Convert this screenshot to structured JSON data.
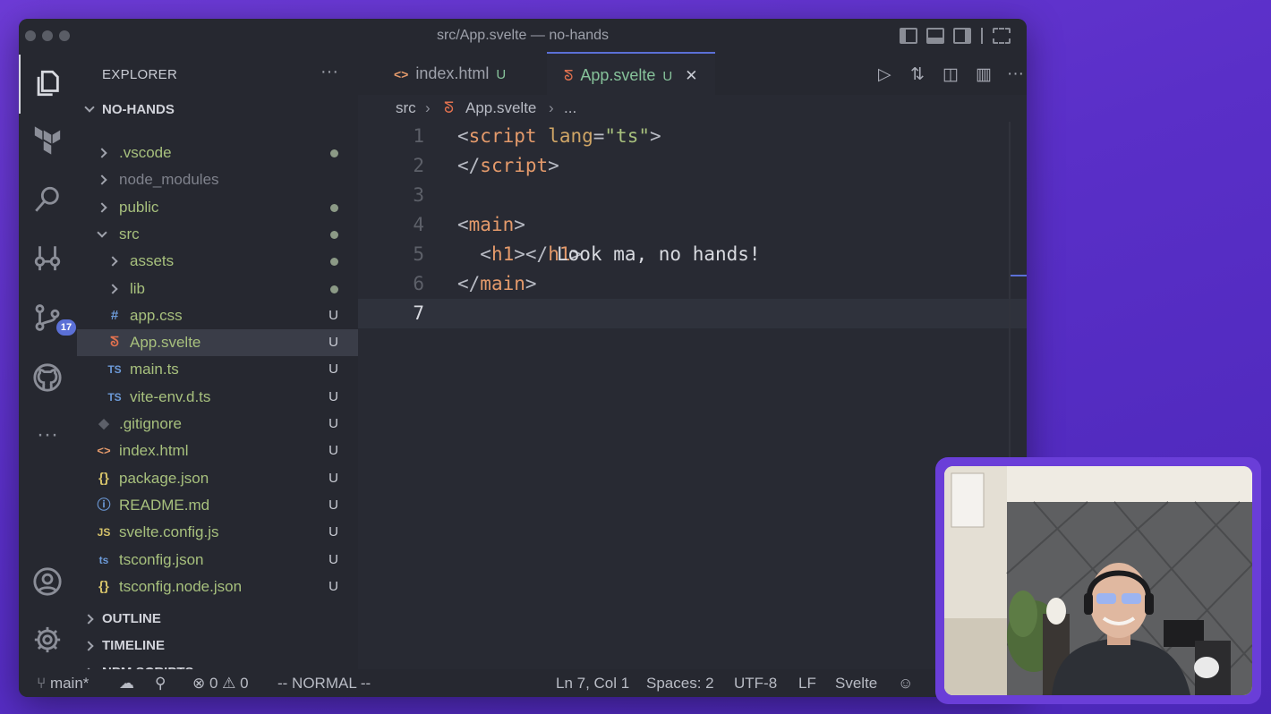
{
  "window": {
    "title": "src/App.svelte — no-hands"
  },
  "sidebar": {
    "header": "EXPLORER",
    "more": "···",
    "root": "NO-HANDS",
    "tree": [
      {
        "label": ".vscode",
        "kind": "folder",
        "depth": 1,
        "open": false,
        "status": "dot",
        "color": "#a7c07d"
      },
      {
        "label": "node_modules",
        "kind": "folder",
        "depth": 1,
        "open": false,
        "status": "",
        "color": "#7f828c"
      },
      {
        "label": "public",
        "kind": "folder",
        "depth": 1,
        "open": false,
        "status": "dot",
        "color": "#a7c07d"
      },
      {
        "label": "src",
        "kind": "folder",
        "depth": 1,
        "open": true,
        "status": "dot",
        "color": "#a7c07d"
      },
      {
        "label": "assets",
        "kind": "folder",
        "depth": 2,
        "open": false,
        "status": "dot",
        "color": "#a7c07d"
      },
      {
        "label": "lib",
        "kind": "folder",
        "depth": 2,
        "open": false,
        "status": "dot",
        "color": "#a7c07d"
      },
      {
        "label": "app.css",
        "kind": "file",
        "icon": "#",
        "depth": 2,
        "status": "U",
        "color": "#a7c07d",
        "iconColor": "#6c9ad8"
      },
      {
        "label": "App.svelte",
        "kind": "file",
        "icon": "svelte",
        "depth": 2,
        "status": "U",
        "color": "#a7c07d",
        "iconColor": "#e0714f",
        "selected": true
      },
      {
        "label": "main.ts",
        "kind": "file",
        "icon": "TS",
        "depth": 2,
        "status": "U",
        "color": "#a7c07d",
        "iconColor": "#6c9ad8"
      },
      {
        "label": "vite-env.d.ts",
        "kind": "file",
        "icon": "TS",
        "depth": 2,
        "status": "U",
        "color": "#a7c07d",
        "iconColor": "#6c9ad8"
      },
      {
        "label": ".gitignore",
        "kind": "file",
        "icon": "◆",
        "depth": 1,
        "status": "U",
        "color": "#a7c07d",
        "iconColor": "#5d6069"
      },
      {
        "label": "index.html",
        "kind": "file",
        "icon": "<>",
        "depth": 1,
        "status": "U",
        "color": "#a7c07d",
        "iconColor": "#e49a6b"
      },
      {
        "label": "package.json",
        "kind": "file",
        "icon": "{}",
        "depth": 1,
        "status": "U",
        "color": "#a7c07d",
        "iconColor": "#d6c36a"
      },
      {
        "label": "README.md",
        "kind": "file",
        "icon": "ⓘ",
        "depth": 1,
        "status": "U",
        "color": "#a7c07d",
        "iconColor": "#6c9ad8"
      },
      {
        "label": "svelte.config.js",
        "kind": "file",
        "icon": "JS",
        "depth": 1,
        "status": "U",
        "color": "#a7c07d",
        "iconColor": "#d6c36a"
      },
      {
        "label": "tsconfig.json",
        "kind": "file",
        "icon": "ts",
        "depth": 1,
        "status": "U",
        "color": "#a7c07d",
        "iconColor": "#6c9ad8"
      },
      {
        "label": "tsconfig.node.json",
        "kind": "file",
        "icon": "{}",
        "depth": 1,
        "status": "U",
        "color": "#a7c07d",
        "iconColor": "#d6c36a"
      }
    ],
    "panels": [
      "OUTLINE",
      "TIMELINE",
      "NPM SCRIPTS"
    ]
  },
  "activity": {
    "scm_badge": "17"
  },
  "tabs": [
    {
      "label": "index.html",
      "status": "U",
      "icon": "<>",
      "active": false
    },
    {
      "label": "App.svelte",
      "status": "U",
      "icon": "svelte",
      "active": true,
      "close": "✕"
    }
  ],
  "breadcrumb": {
    "folder": "src",
    "file": "App.svelte",
    "rest": "..."
  },
  "code": [
    {
      "n": "1",
      "tokens": [
        [
          "pu",
          "<"
        ],
        [
          "tg",
          "script"
        ],
        [
          "pu",
          " "
        ],
        [
          "at",
          "lang"
        ],
        [
          "pu",
          "="
        ],
        [
          "str",
          "\"ts\""
        ],
        [
          "pu",
          ">"
        ]
      ]
    },
    {
      "n": "2",
      "tokens": [
        [
          "pu",
          "</"
        ],
        [
          "tg",
          "script"
        ],
        [
          "pu",
          ">"
        ]
      ]
    },
    {
      "n": "3",
      "tokens": []
    },
    {
      "n": "4",
      "tokens": [
        [
          "pu",
          "<"
        ],
        [
          "tg",
          "main"
        ],
        [
          "pu",
          ">"
        ]
      ]
    },
    {
      "n": "5",
      "tokens": [
        [
          "pu",
          "  <"
        ],
        [
          "tg",
          "h1"
        ],
        [
          "pu",
          ">"
        ],
        [
          "src",
          "Look ma, no hands!"
        ],
        [
          "pu",
          "</"
        ],
        [
          "tg",
          "h1"
        ],
        [
          "pu",
          ">"
        ]
      ]
    },
    {
      "n": "6",
      "tokens": [
        [
          "pu",
          "</"
        ],
        [
          "tg",
          "main"
        ],
        [
          "pu",
          ">"
        ]
      ]
    },
    {
      "n": "7",
      "tokens": [],
      "current": true
    }
  ],
  "status": {
    "branch": "main*",
    "errors": "0",
    "warnings": "0",
    "mode": "-- NORMAL --",
    "position": "Ln 7, Col 1",
    "spaces": "Spaces: 2",
    "encoding": "UTF-8",
    "eol": "LF",
    "language": "Svelte"
  }
}
